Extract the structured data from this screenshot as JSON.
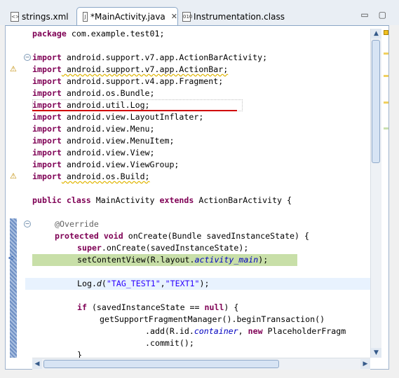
{
  "tabs": [
    {
      "label": "strings.xml"
    },
    {
      "label": "*MainActivity.java",
      "close": "✕"
    },
    {
      "label": "Instrumentation.class"
    }
  ],
  "window_controls": {
    "minimize": "▭",
    "maximize": "▢"
  },
  "code": {
    "package_kw": "package",
    "package_name": " com.example.test01;",
    "import_kw": "import",
    "imports": [
      " android.support.v7.app.ActionBarActivity;",
      " android.support.v7.app.ActionBar;",
      " android.support.v4.app.Fragment;",
      " android.os.Bundle;",
      " android.util.Log;",
      " android.view.LayoutInflater;",
      " android.view.Menu;",
      " android.view.MenuItem;",
      " android.view.View;",
      " android.view.ViewGroup;",
      " android.os.Build;"
    ],
    "class_line": {
      "kw1": "public",
      "kw2": "class",
      "name": " MainActivity ",
      "kw3": "extends",
      "rest": " ActionBarActivity {"
    },
    "override": "@Override",
    "oncreate": {
      "kw1": "protected",
      "kw2": "void",
      "rest": " onCreate(Bundle savedInstanceState) {"
    },
    "super_line": {
      "kw": "super",
      "rest": ".onCreate(savedInstanceState);"
    },
    "setcontent": {
      "pre": "setContentView(R.layout.",
      "ital": "activity_main",
      "post": ");"
    },
    "log_line": {
      "pre": "Log.",
      "ital": "d",
      "open": "(",
      "s1": "\"TAG_TEST1\"",
      "comma": ",",
      "s2": "\"TEXT1\"",
      "close": ");"
    },
    "if_line": {
      "kw": "if",
      "pre": " (savedInstanceState == ",
      "null": "null",
      "post": ") {"
    },
    "fragment_line": "getSupportFragmentManager().beginTransaction()",
    "add_line": {
      "pre": ".add(R.id.",
      "ital": "container",
      "mid": ", ",
      "kw": "new",
      "rest": " PlaceholderFragm"
    },
    "commit_line": ".commit();",
    "brace_line": "}"
  },
  "colors": {
    "keyword": "#7f0055",
    "string": "#2a00ff",
    "field": "#0000c0",
    "highlight": "#c8dfa8",
    "error": "#d00000"
  }
}
